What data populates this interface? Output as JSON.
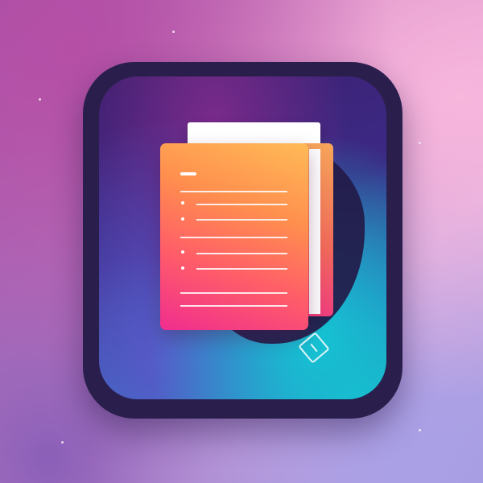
{
  "icons": {
    "app": "document-app-icon",
    "document": "document-icon",
    "tag": "tag-diamond-icon"
  },
  "colors": {
    "background_pink": "#d88bc6",
    "app_frame": "#2a1f4c",
    "app_inner_purple": "#3c2a86",
    "app_inner_teal": "#18b7c9",
    "document_orange": "#ff8f4e",
    "document_pink": "#f02d8f",
    "paper_white": "#ffffff"
  }
}
